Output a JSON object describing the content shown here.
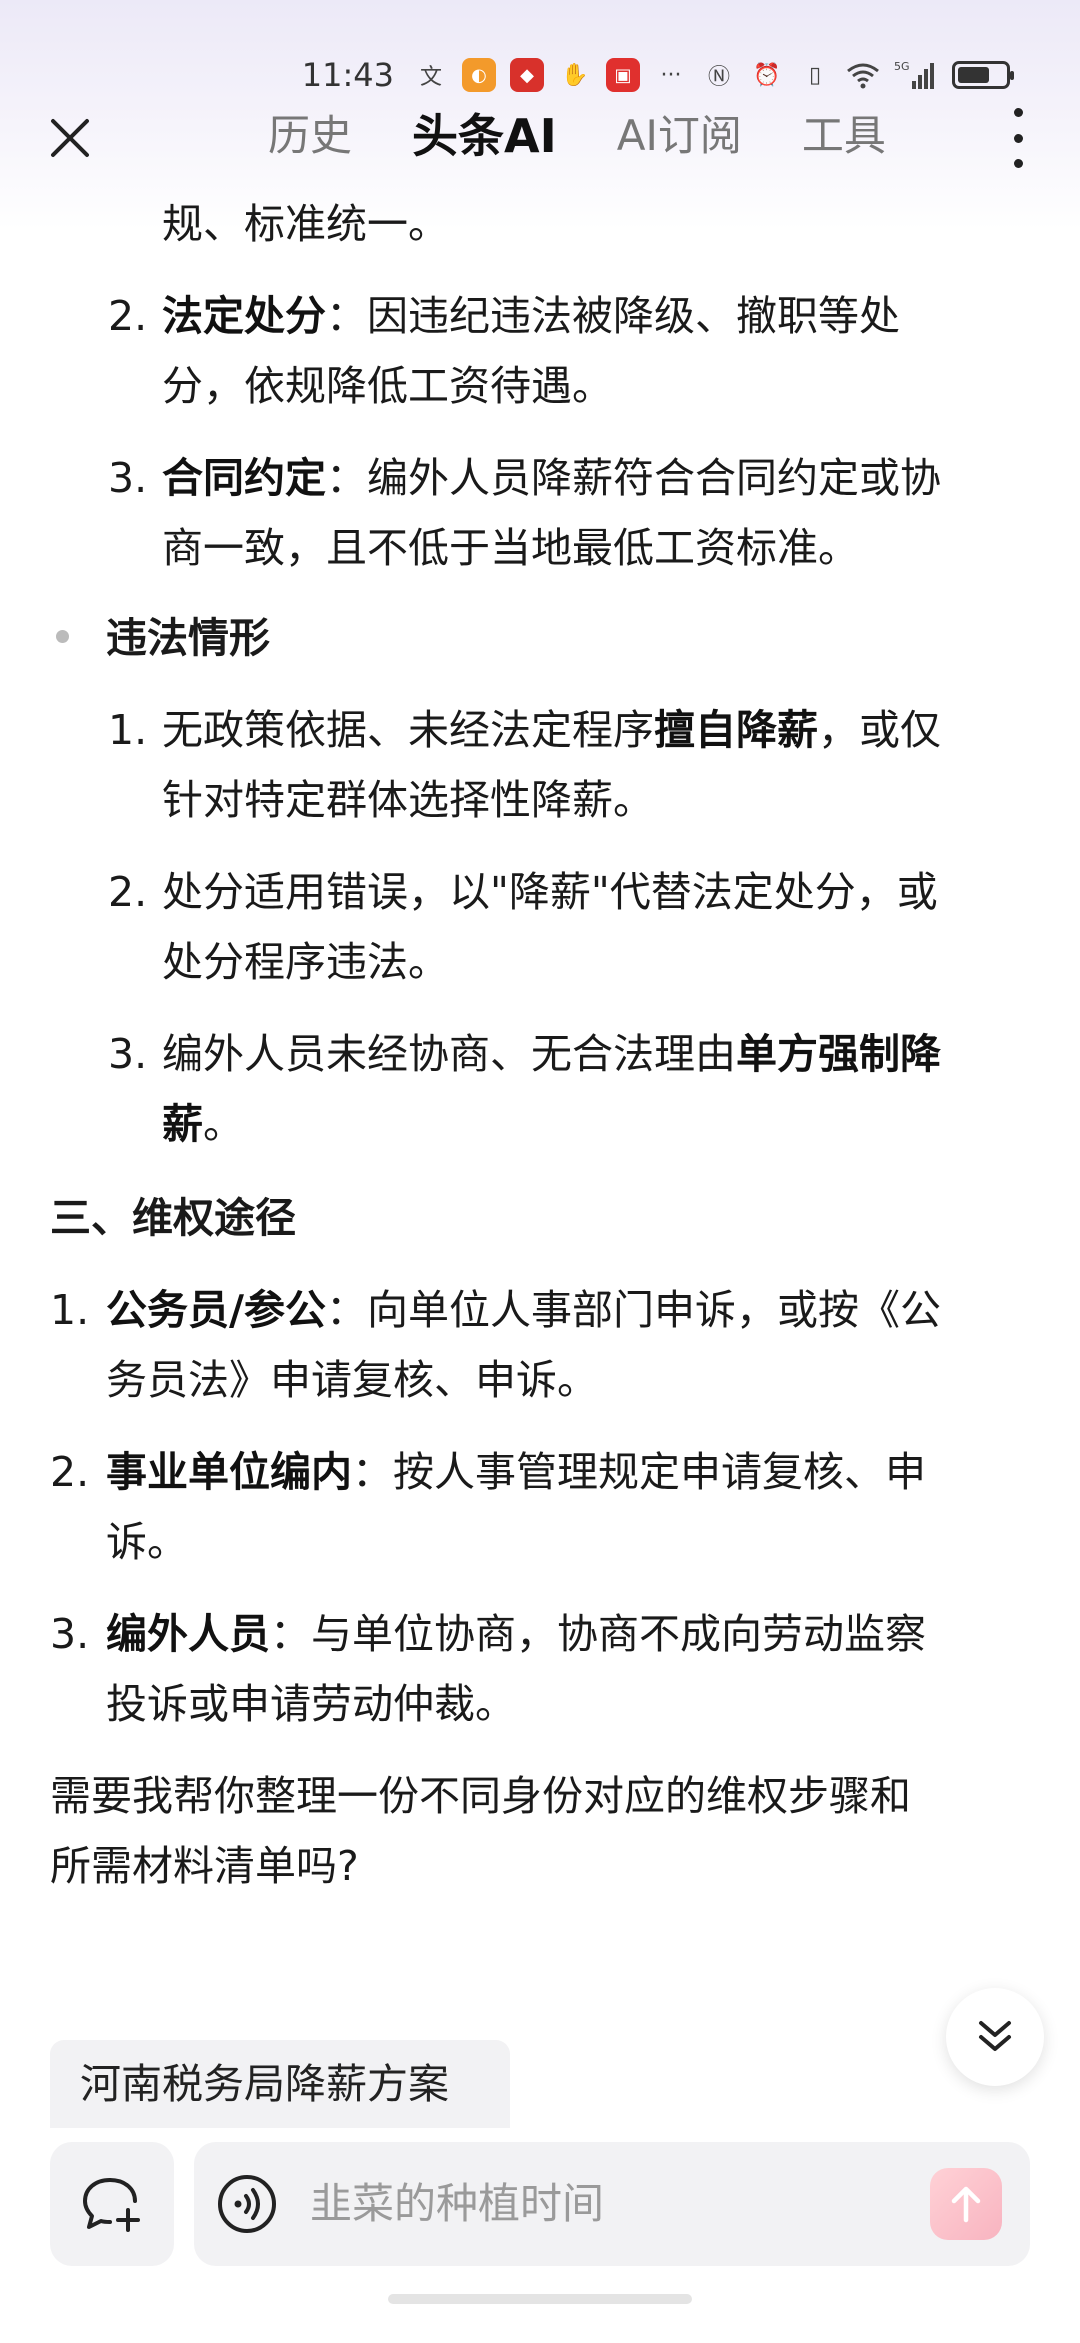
{
  "status_bar": {
    "time": "11:43",
    "network": "5G",
    "icons": [
      "translate-icon",
      "app-icon-orange",
      "app-icon-red",
      "app-icon-hand",
      "app-icon-red-square",
      "more-dots-icon",
      "nfc-icon",
      "alarm-icon",
      "vibrate-icon",
      "wifi-icon",
      "signal-icon",
      "battery-icon"
    ],
    "more_dots": "···"
  },
  "nav": {
    "tabs": [
      {
        "label": "历史",
        "active": false
      },
      {
        "label": "头条AI",
        "active": true
      },
      {
        "label": "AI订阅",
        "active": false
      },
      {
        "label": "工具",
        "active": false
      }
    ]
  },
  "content": {
    "l_top_cont": "规、标准统一。",
    "legal_items": [
      {
        "num": "2.",
        "bold": "法定处分",
        "rest1": "：因违纪违法被降级、撤职等处",
        "rest2": "分，依规降低工资待遇。"
      },
      {
        "num": "3.",
        "bold": "合同约定",
        "rest1": "：编外人员降薪符合合同约定或协",
        "rest2": "商一致，且不低于当地最低工资标准。"
      }
    ],
    "illegal_heading": "违法情形",
    "illegal_items": [
      {
        "num": "1.",
        "pre": "无政策依据、未经法定程序",
        "bold": "擅自降薪",
        "post": "，或仅",
        "line2": "针对特定群体选择性降薪。"
      },
      {
        "num": "2.",
        "line1": "处分适用错误，以\"降薪\"代替法定处分，或",
        "line2": "处分程序违法。"
      },
      {
        "num": "3.",
        "pre": "编外人员未经协商、无合法理由",
        "bold": "单方强制降",
        "line2_bold": "薪",
        "line2_post": "。"
      }
    ],
    "section3_heading": "三、维权途径",
    "rights_items": [
      {
        "num": "1.",
        "bold": "公务员/参公",
        "rest1": "：向单位人事部门申诉，或按《公",
        "rest2": "务员法》申请复核、申诉。"
      },
      {
        "num": "2.",
        "bold": "事业单位编内",
        "rest1": "：按人事管理规定申请复核、申",
        "rest2": "诉。"
      },
      {
        "num": "3.",
        "bold": "编外人员",
        "rest1": "：与单位协商，协商不成向劳动监察",
        "rest2": "投诉或申请劳动仲裁。"
      }
    ],
    "followup_line1": "需要我帮你整理一份不同身份对应的维权步骤和",
    "followup_line2": "所需材料清单吗?"
  },
  "suggestion_chip": "河南税务局降薪方案",
  "input": {
    "placeholder": "韭菜的种植时间"
  },
  "colors": {
    "accent_send": "#f8b4c0",
    "bg_gradient_top": "#ece9f7"
  }
}
